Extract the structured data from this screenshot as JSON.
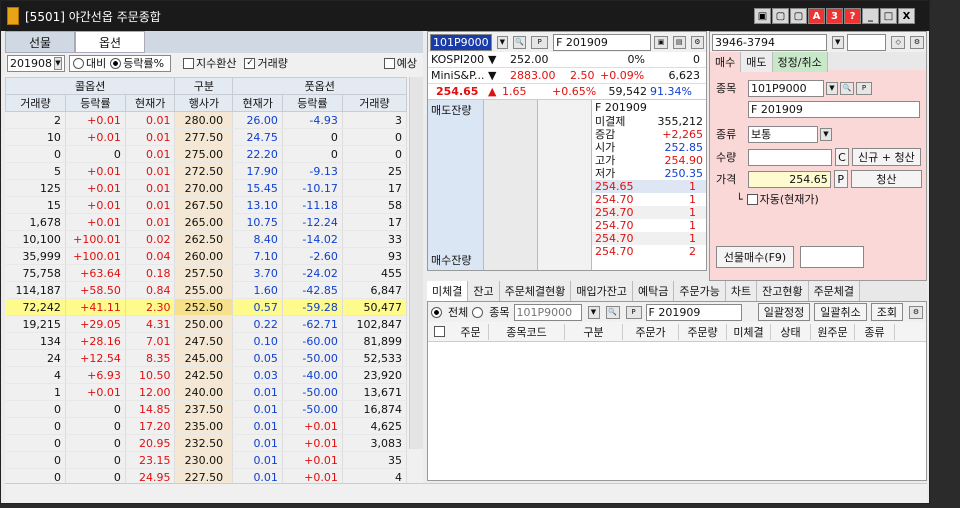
{
  "window": {
    "title": "[5501] 야간선옵 주문종합"
  },
  "title_buttons": [
    "▣",
    "▢",
    "▢",
    "A",
    "3",
    "?",
    "_",
    "□",
    "X"
  ],
  "left": {
    "tabs": [
      "선물",
      "옵션"
    ],
    "month": "201908",
    "radio_compare": "대비",
    "radio_rate": "등락률%",
    "chk_index": "지수환산",
    "chk_volume": "거래량",
    "chk_expect": "예상",
    "header_call": "콜옵션",
    "header_gubun": "구분",
    "header_put": "풋옵션",
    "cols": [
      "거래량",
      "등락률",
      "현재가",
      "행사가",
      "현재가",
      "등락률",
      "거래량"
    ],
    "rows": [
      [
        "2",
        "+0.01",
        "0.01",
        "280.00",
        "26.00",
        "-4.93",
        "3"
      ],
      [
        "10",
        "+0.01",
        "0.01",
        "277.50",
        "24.75",
        "0",
        "0"
      ],
      [
        "0",
        "0",
        "0.01",
        "275.00",
        "22.20",
        "0",
        "0"
      ],
      [
        "5",
        "+0.01",
        "0.01",
        "272.50",
        "17.90",
        "-9.13",
        "25"
      ],
      [
        "125",
        "+0.01",
        "0.01",
        "270.00",
        "15.45",
        "-10.17",
        "17"
      ],
      [
        "15",
        "+0.01",
        "0.01",
        "267.50",
        "13.10",
        "-11.18",
        "58"
      ],
      [
        "1,678",
        "+0.01",
        "0.01",
        "265.00",
        "10.75",
        "-12.24",
        "17"
      ],
      [
        "10,100",
        "+100.01",
        "0.02",
        "262.50",
        "8.40",
        "-14.02",
        "33"
      ],
      [
        "35,999",
        "+100.01",
        "0.04",
        "260.00",
        "7.10",
        "-2.60",
        "93"
      ],
      [
        "75,758",
        "+63.64",
        "0.18",
        "257.50",
        "3.70",
        "-24.02",
        "455"
      ],
      [
        "114,187",
        "+58.50",
        "0.84",
        "255.00",
        "1.60",
        "-42.85",
        "6,847"
      ],
      [
        "72,242",
        "+41.11",
        "2.30",
        "252.50",
        "0.57",
        "-59.28",
        "50,477"
      ],
      [
        "19,215",
        "+29.05",
        "4.31",
        "250.00",
        "0.22",
        "-62.71",
        "102,847"
      ],
      [
        "134",
        "+28.16",
        "7.01",
        "247.50",
        "0.10",
        "-60.00",
        "81,899"
      ],
      [
        "24",
        "+12.54",
        "8.35",
        "245.00",
        "0.05",
        "-50.00",
        "52,533"
      ],
      [
        "4",
        "+6.93",
        "10.50",
        "242.50",
        "0.03",
        "-40.00",
        "23,920"
      ],
      [
        "1",
        "+0.01",
        "12.00",
        "240.00",
        "0.01",
        "-50.00",
        "13,671"
      ],
      [
        "0",
        "0",
        "14.85",
        "237.50",
        "0.01",
        "-50.00",
        "16,874"
      ],
      [
        "0",
        "0",
        "17.20",
        "235.00",
        "0.01",
        "+0.01",
        "4,625"
      ],
      [
        "0",
        "0",
        "20.95",
        "232.50",
        "0.01",
        "+0.01",
        "3,083"
      ],
      [
        "0",
        "0",
        "23.15",
        "230.00",
        "0.01",
        "+0.01",
        "35"
      ],
      [
        "0",
        "0",
        "24.95",
        "227.50",
        "0.01",
        "+0.01",
        "4"
      ]
    ]
  },
  "mid": {
    "code": "101P9000",
    "name": "F 201909",
    "kospi_label": "KOSPI200",
    "kospi_val": "252.00",
    "kospi_pct": "0%",
    "kospi_n": "0",
    "mini_label": "MiniS&P...",
    "mini_val": "2883.00",
    "mini_chg": "2.50",
    "mini_pct": "+0.09%",
    "mini_vol": "6,623",
    "price": "254.65",
    "chg": "1.65",
    "pct": "+0.65%",
    "vol": "59,542",
    "ratio": "91.34%",
    "ask_label": "매도잔량",
    "bid_label": "매수잔량",
    "info_name": "F 201909",
    "info": [
      [
        "미결제",
        "355,212"
      ],
      [
        "증감",
        "+2,265"
      ],
      [
        "시가",
        "252.85"
      ],
      [
        "고가",
        "254.90"
      ],
      [
        "저가",
        "250.35"
      ]
    ],
    "levels": [
      [
        "254.65",
        "1"
      ],
      [
        "254.70",
        "1"
      ],
      [
        "254.70",
        "1"
      ],
      [
        "254.70",
        "1"
      ],
      [
        "254.70",
        "1"
      ],
      [
        "254.70",
        "2"
      ]
    ]
  },
  "right": {
    "account": "3946-3794",
    "tabs": [
      "매수",
      "매도",
      "정정/취소"
    ],
    "lbl_item": "종목",
    "item_code": "101P9000",
    "item_name": "F 201909",
    "lbl_type": "종류",
    "type_val": "보통",
    "lbl_qty": "수량",
    "btn_c": "C",
    "btn_new": "신규 + 청산",
    "lbl_price": "가격",
    "price_val": "254.65",
    "btn_p": "P",
    "btn_settle": "청산",
    "chk_auto": "자동(현재가)",
    "btn_buy": "선물매수(F9)"
  },
  "bottom": {
    "tabs": [
      "미체결",
      "잔고",
      "주문체결현황",
      "매입가잔고",
      "예탁금",
      "주문가능",
      "차트",
      "잔고현황",
      "주문체결"
    ],
    "radio_all": "전체",
    "radio_item": "종목",
    "code": "101P9000",
    "name": "F 201909",
    "btn_fix": "일괄정정",
    "btn_cancel": "일괄취소",
    "btn_query": "조회",
    "cols": [
      "주문",
      "종목코드",
      "구분",
      "주문가",
      "주문량",
      "미체결",
      "상태",
      "원주문",
      "종류"
    ]
  }
}
